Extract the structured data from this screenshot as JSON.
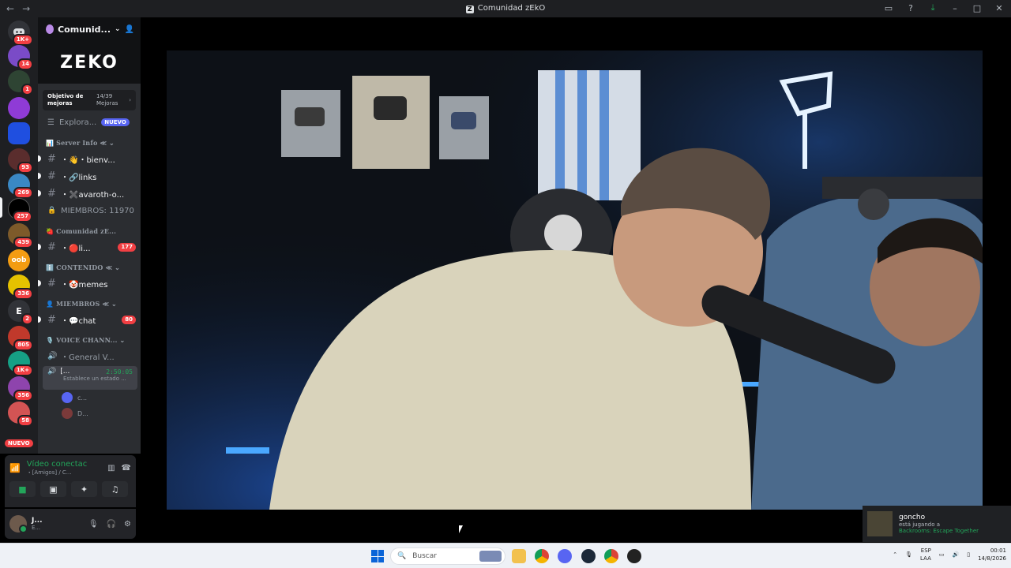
{
  "window": {
    "title": "Comunidad zEkO",
    "title_logo": "Z"
  },
  "rail": {
    "home_badge": "1K+",
    "servers": [
      {
        "badge": "14"
      },
      {
        "badge": "1"
      },
      {
        "badge": ""
      },
      {
        "badge": ""
      },
      {
        "badge": "93"
      },
      {
        "badge": "269"
      },
      {
        "badge": "257"
      },
      {
        "badge": "439"
      },
      {
        "badge": "oob"
      },
      {
        "badge": "336"
      },
      {
        "letter": "E",
        "badge": "2"
      },
      {
        "badge": "805"
      },
      {
        "badge": "1K+"
      },
      {
        "badge": "356"
      },
      {
        "badge": "58"
      }
    ],
    "new_label": "NUEVO"
  },
  "guild": {
    "name": "Comunid...",
    "banner_text": "ZEKO",
    "boost_goal_label": "Objetivo de mejoras",
    "boost_count": "14/39",
    "boost_unit": "Mejoras",
    "explore_label": "Explora...",
    "explore_badge": "NUEVO"
  },
  "categories": [
    {
      "label": "📊 Server Info ≪ ⌄",
      "channels": [
        {
          "name": "・👋・bienv...",
          "unread": true
        },
        {
          "name": "・🔗links",
          "unread": true
        },
        {
          "name": "・✖️avaroth-o...",
          "unread": true
        },
        {
          "name": "MIEMBROS: 11970",
          "locked": true
        }
      ]
    },
    {
      "label": "🍓 Comunidad zE...",
      "channels": [
        {
          "name": "・🔴li...",
          "unread": true,
          "count": "177"
        }
      ]
    },
    {
      "label": "ℹ️ CONTENIDO ≪ ⌄",
      "channels": [
        {
          "name": "・🤡memes",
          "unread": true
        }
      ]
    },
    {
      "label": "👤 MIEMBROS ≪ ⌄",
      "channels": [
        {
          "name": "・💬chat",
          "unread": true,
          "count": "80"
        }
      ]
    },
    {
      "label": "🎙️ VOICE CHANN... ⌄",
      "channels": [
        {
          "name": "・General V...",
          "voice": true
        }
      ]
    }
  ],
  "active_voice": {
    "name": "[...",
    "timer": "2:50:05",
    "sub": "Establece un estado ..."
  },
  "voice_users": [
    {
      "name": "c..."
    },
    {
      "name": "D..."
    }
  ],
  "voice_panel": {
    "status": "Vídeo conectac",
    "sub": "・[Amigos] / C..."
  },
  "user": {
    "name": "J...",
    "status": "E..."
  },
  "toast": {
    "name": "goncho",
    "line1": "está jugando a",
    "line2": "Backrooms: Escape Together"
  },
  "taskbar": {
    "search_placeholder": "Buscar",
    "lang": "ESP",
    "lang2": "LAA",
    "time": "00:01",
    "date": "14/8/2026"
  }
}
